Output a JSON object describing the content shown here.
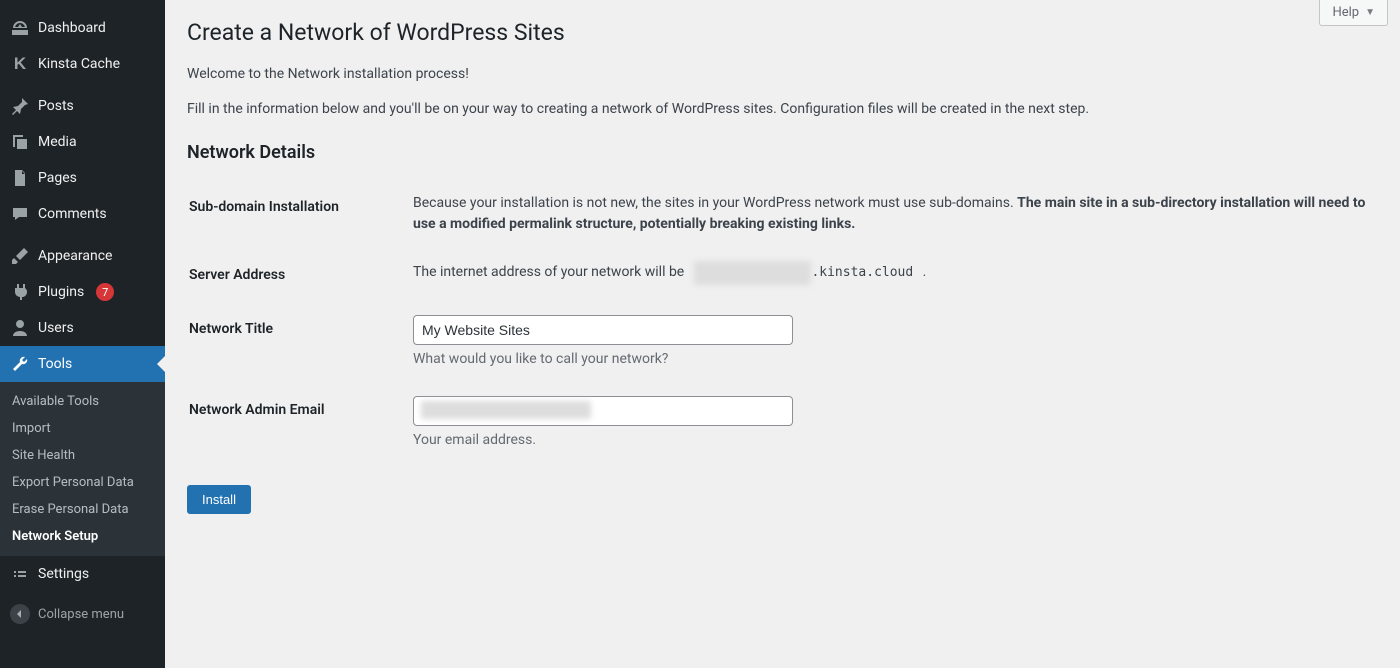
{
  "help": {
    "label": "Help"
  },
  "sidebar": {
    "dashboard": "Dashboard",
    "kinsta_cache": "Kinsta Cache",
    "posts": "Posts",
    "media": "Media",
    "pages": "Pages",
    "comments": "Comments",
    "appearance": "Appearance",
    "plugins": "Plugins",
    "plugins_badge": "7",
    "users": "Users",
    "tools": "Tools",
    "tools_sub": {
      "available": "Available Tools",
      "import": "Import",
      "site_health": "Site Health",
      "export_pd": "Export Personal Data",
      "erase_pd": "Erase Personal Data",
      "network_setup": "Network Setup"
    },
    "settings": "Settings",
    "collapse": "Collapse menu"
  },
  "page": {
    "title": "Create a Network of WordPress Sites",
    "intro1": "Welcome to the Network installation process!",
    "intro2": "Fill in the information below and you'll be on your way to creating a network of WordPress sites. Configuration files will be created in the next step.",
    "section_heading": "Network Details",
    "subdomain": {
      "label": "Sub-domain Installation",
      "text_a": "Because your installation is not new, the sites in your WordPress network must use sub-domains. ",
      "text_b": "The main site in a sub-directory installation will need to use a modified permalink structure, potentially breaking existing links."
    },
    "server": {
      "label": "Server Address",
      "text_a": "The internet address of your network will be ",
      "code_suffix": ".kinsta.cloud",
      "text_b": " ."
    },
    "network_title": {
      "label": "Network Title",
      "value": "My Website Sites",
      "desc": "What would you like to call your network?"
    },
    "admin_email": {
      "label": "Network Admin Email",
      "value": "",
      "desc": "Your email address."
    },
    "install": "Install"
  }
}
